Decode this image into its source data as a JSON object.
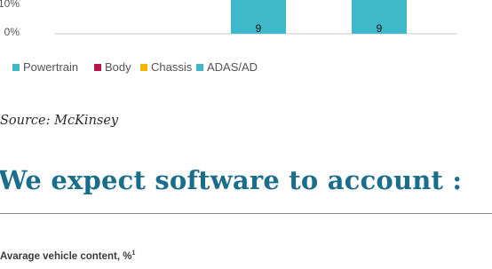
{
  "chart_data": {
    "type": "bar",
    "stacked": true,
    "categories": [
      "",
      "",
      ""
    ],
    "y_tick_labels": [
      "10%",
      "0%"
    ],
    "series": [
      {
        "name": "Powertrain",
        "color": "#3fb8c9",
        "values": [
          null,
          9,
          9
        ],
        "labels": [
          "",
          "9",
          "9"
        ]
      },
      {
        "name": "Body",
        "color": "#b5174a",
        "values": [
          null,
          null,
          null
        ]
      },
      {
        "name": "Chassis",
        "color": "#f2b705",
        "values": [
          null,
          null,
          null
        ]
      },
      {
        "name": "ADAS/AD",
        "color": "#3fb8c9",
        "values": [
          null,
          null,
          null
        ]
      }
    ],
    "legend_position": "bottom-left",
    "grid": false
  },
  "source": "Source: McKinsey",
  "headline": "We expect software to account :",
  "subtitle": {
    "text": "Avarage vehicle content, %",
    "footnote": "1"
  }
}
